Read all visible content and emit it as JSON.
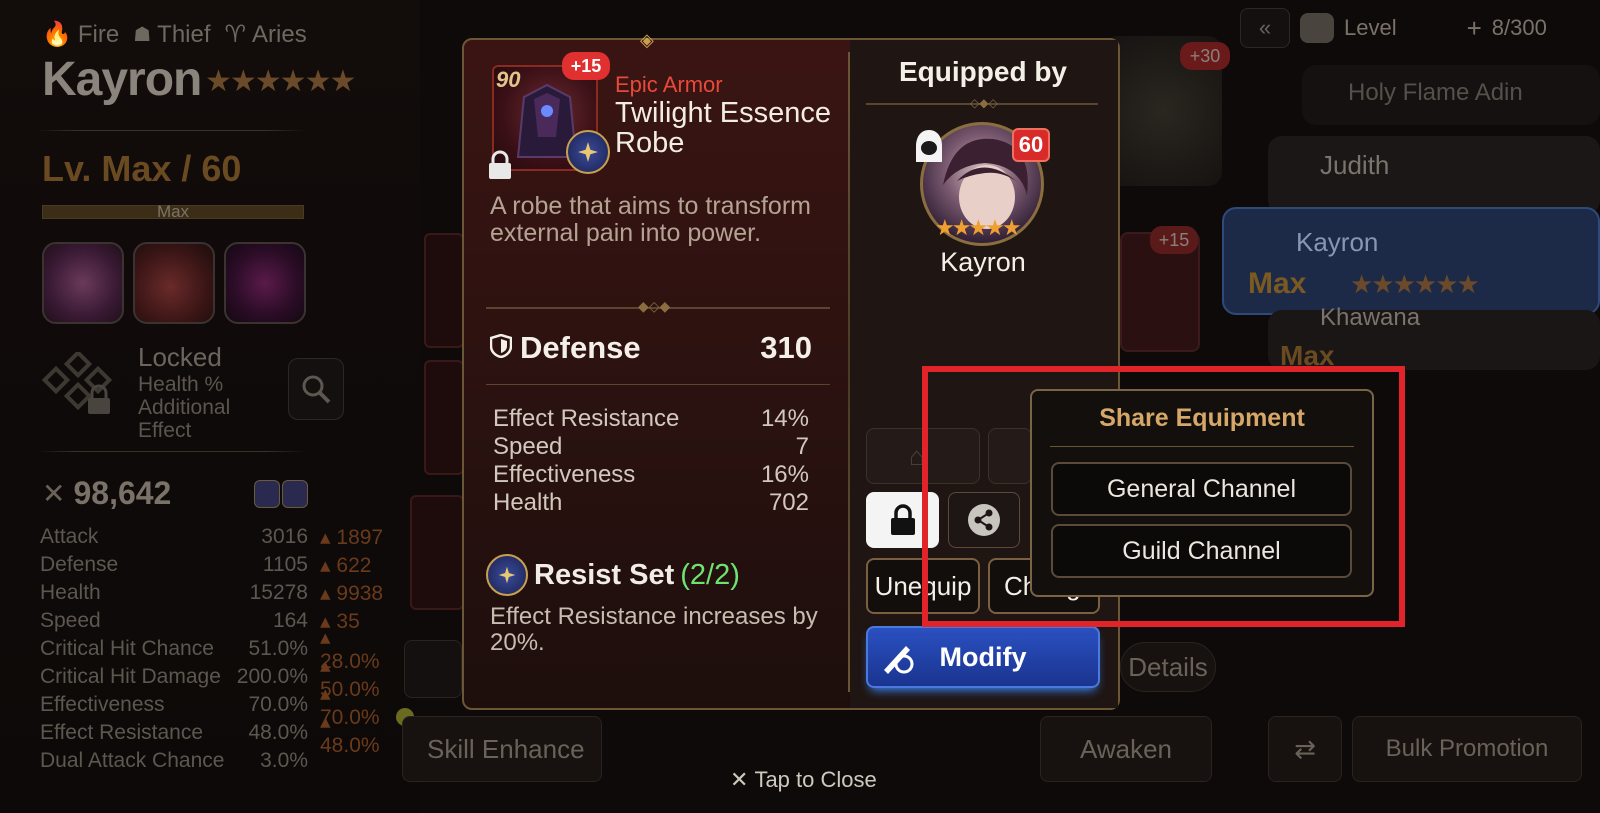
{
  "hero": {
    "element": "Fire",
    "class": "Thief",
    "horoscope": "Aries",
    "name": "Kayron",
    "stars": "★★★★★★",
    "level": "Lv. Max / 60",
    "level_bar_label": "Max",
    "locked_title": "Locked",
    "locked_desc": "Health % Additional Effect",
    "combat_power": "98,642",
    "stats": [
      {
        "name": "Attack",
        "value": "3016",
        "bonus": "1897"
      },
      {
        "name": "Defense",
        "value": "1105",
        "bonus": "622"
      },
      {
        "name": "Health",
        "value": "15278",
        "bonus": "9938"
      },
      {
        "name": "Speed",
        "value": "164",
        "bonus": "35"
      },
      {
        "name": "Critical Hit Chance",
        "value": "51.0%",
        "bonus": "28.0%"
      },
      {
        "name": "Critical Hit Damage",
        "value": "200.0%",
        "bonus": "50.0%"
      },
      {
        "name": "Effectiveness",
        "value": "70.0%",
        "bonus": "70.0%"
      },
      {
        "name": "Effect Resistance",
        "value": "48.0%",
        "bonus": "48.0%"
      },
      {
        "name": "Dual Attack Chance",
        "value": "3.0%",
        "bonus": ""
      }
    ]
  },
  "top_bar": {
    "level_label": "Level",
    "capacity": "8/300"
  },
  "hero_list": [
    {
      "name": "Holy Flame Adin"
    },
    {
      "name": "Judith"
    },
    {
      "name": "Kayron",
      "level": "Max"
    },
    {
      "name": "Khawana",
      "level": "Max"
    }
  ],
  "background_buttons": {
    "skill_enhance": "Skill Enhance",
    "awaken": "Awaken",
    "details": "Details",
    "bulk_promotion": "Bulk Promotion",
    "plus30": "+30",
    "plus15": "+15"
  },
  "item": {
    "enhance": "+15",
    "level": "90",
    "rarity": "Epic Armor",
    "name": "Twilight Essence Robe",
    "description": "A robe that aims to transform external pain into power.",
    "main_stat": {
      "name": "Defense",
      "value": "310"
    },
    "sub_stats": [
      {
        "name": "Effect Resistance",
        "value": "14%"
      },
      {
        "name": "Speed",
        "value": "7"
      },
      {
        "name": "Effectiveness",
        "value": "16%"
      },
      {
        "name": "Health",
        "value": "702"
      }
    ],
    "set_name": "Resist Set",
    "set_count": "(2/2)",
    "set_description": "Effect Resistance increases by 20%."
  },
  "equipped_by": {
    "title": "Equipped by",
    "hero_name": "Kayron",
    "hero_level": "60",
    "stars": "★★★★★"
  },
  "actions": {
    "unequip": "Unequip",
    "change": "Change",
    "modify": "Modify"
  },
  "share_menu": {
    "title": "Share Equipment",
    "general": "General Channel",
    "guild": "Guild Channel"
  },
  "footer": {
    "tap_to_close": "Tap to Close"
  },
  "colors": {
    "highlight_box": "#e0242a",
    "epic_rarity": "#e84a3a",
    "set_count": "#6fe36f",
    "modify_blue": "#2a50c0"
  }
}
